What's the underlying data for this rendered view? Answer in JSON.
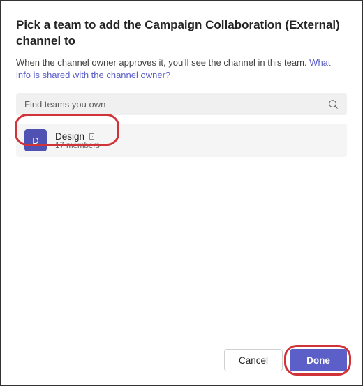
{
  "dialog": {
    "title": "Pick a team to add the Campaign Collaboration (External) channel to",
    "subtitle_text": "When the channel owner approves it, you'll see the channel in this team. ",
    "link_text": "What info is shared with the channel owner?"
  },
  "search": {
    "placeholder": "Find teams you own"
  },
  "teams": [
    {
      "avatar_letter": "D",
      "name": "Design",
      "members": "17 members"
    }
  ],
  "footer": {
    "cancel": "Cancel",
    "done": "Done"
  }
}
